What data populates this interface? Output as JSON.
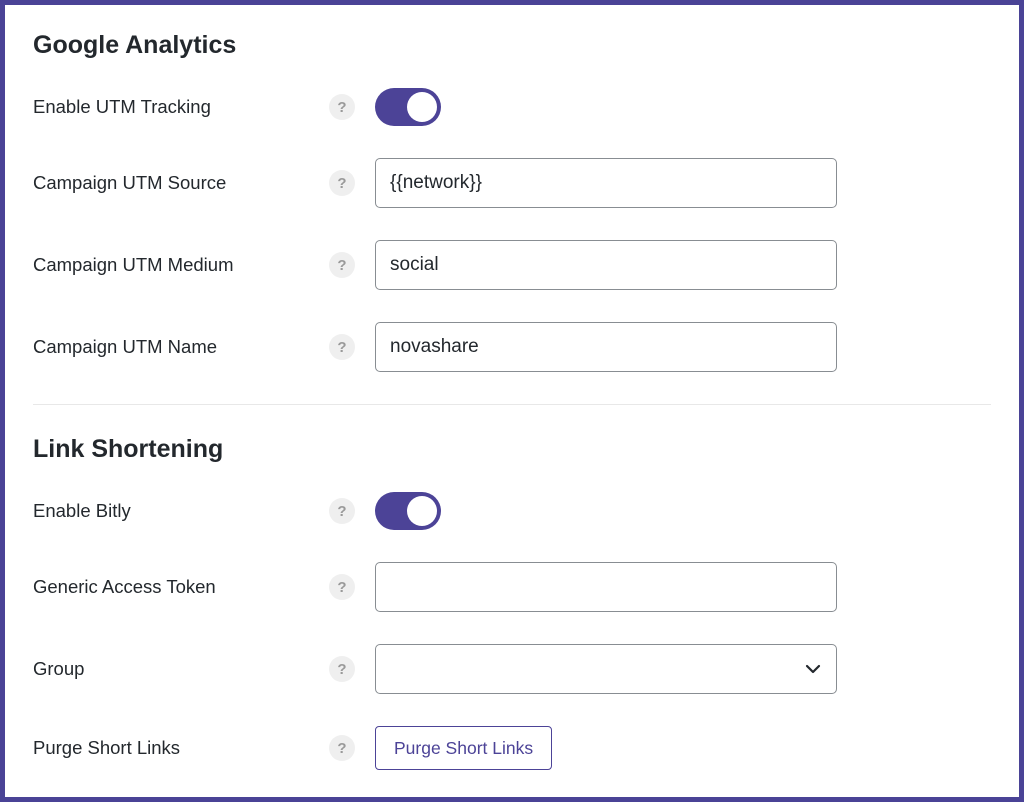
{
  "sections": {
    "ga": {
      "title": "Google Analytics",
      "enable_utm_label": "Enable UTM Tracking",
      "enable_utm_on": true,
      "utm_source_label": "Campaign UTM Source",
      "utm_source_value": "{{network}}",
      "utm_medium_label": "Campaign UTM Medium",
      "utm_medium_value": "social",
      "utm_name_label": "Campaign UTM Name",
      "utm_name_value": "novashare"
    },
    "ls": {
      "title": "Link Shortening",
      "enable_bitly_label": "Enable Bitly",
      "enable_bitly_on": true,
      "token_label": "Generic Access Token",
      "token_value": "",
      "group_label": "Group",
      "group_value": "",
      "purge_label": "Purge Short Links",
      "purge_button": "Purge Short Links"
    }
  },
  "help_glyph": "?"
}
